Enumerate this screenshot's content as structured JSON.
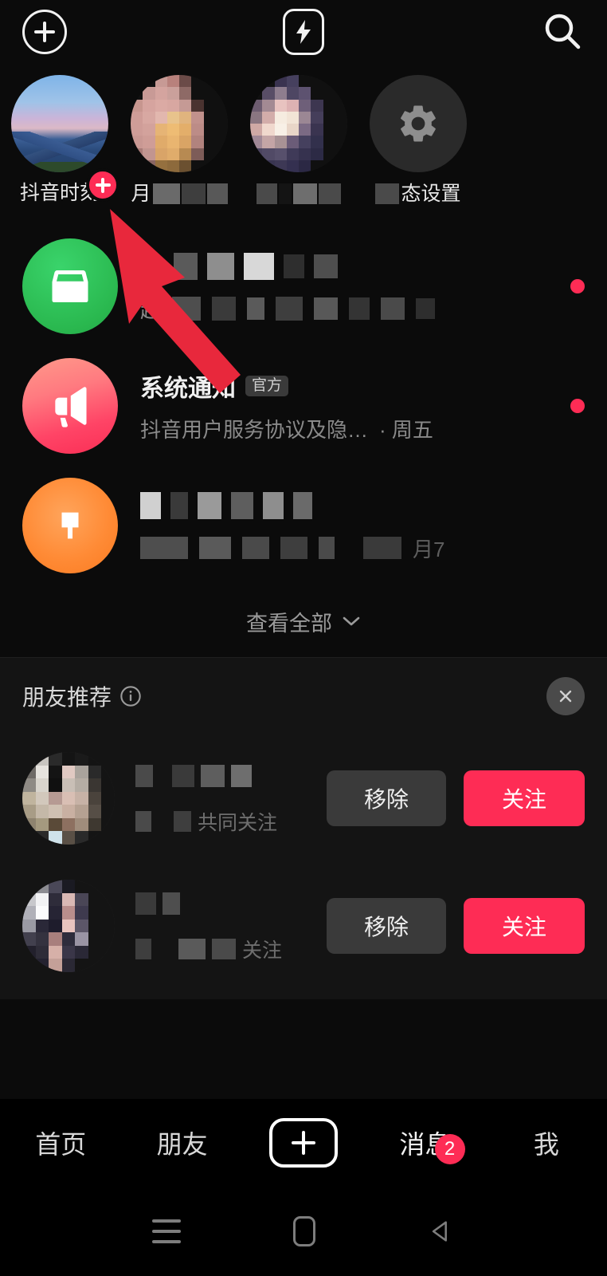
{
  "app": {
    "name": "抖音",
    "screen": "消息"
  },
  "topbar": {
    "add_icon": "circle-plus-icon",
    "flash_icon": "lightning-bolt-icon",
    "search_icon": "search-icon"
  },
  "stories": [
    {
      "label": "抖音时刻",
      "avatar": "landscape-photo",
      "has_add_badge": true,
      "blurred": false
    },
    {
      "label": "月",
      "avatar": "person-photo",
      "has_add_badge": false,
      "blurred": true
    },
    {
      "label": "",
      "avatar": "person-photo",
      "has_add_badge": false,
      "blurred": true
    },
    {
      "label": "态设置",
      "avatar": "gear-icon",
      "has_add_badge": false,
      "blurred": true
    }
  ],
  "messages": [
    {
      "avatar": "inbox-tray-icon",
      "avatar_color": "#2ab84f",
      "title": "服",
      "title_blurred": true,
      "badge": "",
      "subtitle": "超",
      "subtitle_blurred": true,
      "time": "",
      "unread_dot": true
    },
    {
      "avatar": "megaphone-icon",
      "avatar_color": "#fa2e55",
      "title": "系统通知",
      "title_blurred": false,
      "badge": "官方",
      "subtitle": "抖音用户服务协议及隐…",
      "subtitle_blurred": false,
      "time": "· 周五",
      "unread_dot": true
    },
    {
      "avatar": "orange-app-icon",
      "avatar_color": "#f97a20",
      "title": "",
      "title_blurred": true,
      "badge": "",
      "subtitle": "",
      "subtitle_blurred": true,
      "time": "月7",
      "unread_dot": false
    }
  ],
  "view_all": {
    "label": "查看全部",
    "chevron": "chevron-down-icon"
  },
  "recommend": {
    "title": "朋友推荐",
    "info_icon": "info-circle-icon",
    "close_icon": "close-icon",
    "remove_label": "移除",
    "follow_label": "关注",
    "items": [
      {
        "name": "",
        "name_blurred": true,
        "sub": "共同关注",
        "sub_blurred": true,
        "avatar": "user-photo"
      },
      {
        "name": "",
        "name_blurred": true,
        "sub": "关注",
        "sub_blurred": true,
        "avatar": "user-photo"
      }
    ]
  },
  "tabbar": {
    "items": [
      {
        "label": "首页",
        "type": "text",
        "badge": ""
      },
      {
        "label": "朋友",
        "type": "text",
        "badge": ""
      },
      {
        "label": "",
        "type": "plus",
        "badge": ""
      },
      {
        "label": "消息",
        "type": "text",
        "badge": "2"
      },
      {
        "label": "我",
        "type": "text",
        "badge": ""
      }
    ]
  },
  "android_nav": {
    "recents_icon": "recents-icon",
    "home_icon": "home-icon",
    "back_icon": "back-icon"
  },
  "annotation": {
    "arrow": "red-arrow-pointing-to-douyin-moment",
    "color": "#E8283C"
  },
  "colors": {
    "accent": "#FE2C55",
    "background": "#0b0b0b",
    "panel": "#141414",
    "text_primary": "#f0f0f0",
    "text_secondary": "#8a8a8a"
  }
}
